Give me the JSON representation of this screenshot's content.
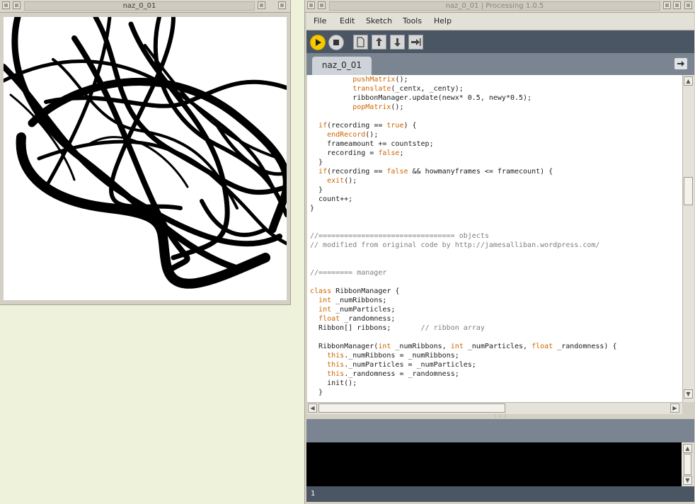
{
  "sketch_window": {
    "title": "naz_0_01"
  },
  "ide_window": {
    "title": "naz_0_01 | Processing 1.0.5"
  },
  "menu": {
    "items": [
      "File",
      "Edit",
      "Sketch",
      "Tools",
      "Help"
    ]
  },
  "toolbar": {
    "buttons": [
      "run-icon",
      "stop-icon",
      "new-icon",
      "open-icon",
      "save-icon",
      "export-icon"
    ]
  },
  "tabs": {
    "active": "naz_0_01"
  },
  "code_lines": [
    "          pushMatrix();",
    "          translate(_centx, _centy);",
    "          ribbonManager.update(newx* 0.5, newy*0.5);",
    "          popMatrix();",
    "",
    "  if(recording == true) {",
    "    endRecord();",
    "    frameamount += countstep;",
    "    recording = false;",
    "  }",
    "  if(recording == false && howmanyframes <= framecount) {",
    "    exit();",
    "  }",
    "  count++;",
    "}",
    "",
    "",
    "//================================ objects",
    "// modified from original code by http://jamesalliban.wordpress.com/",
    "",
    "",
    "//======== manager",
    "",
    "class RibbonManager {",
    "  int _numRibbons;",
    "  int _numParticles;",
    "  float _randomness;",
    "  Ribbon[] ribbons;       // ribbon array",
    "",
    "  RibbonManager(int _numRibbons, int _numParticles, float _randomness) {",
    "    this._numRibbons = _numRibbons;",
    "    this._numParticles = _numParticles;",
    "    this._randomness = _randomness;",
    "    init();",
    "  }"
  ],
  "console": {
    "output": ""
  },
  "status": {
    "line_number": "1"
  }
}
